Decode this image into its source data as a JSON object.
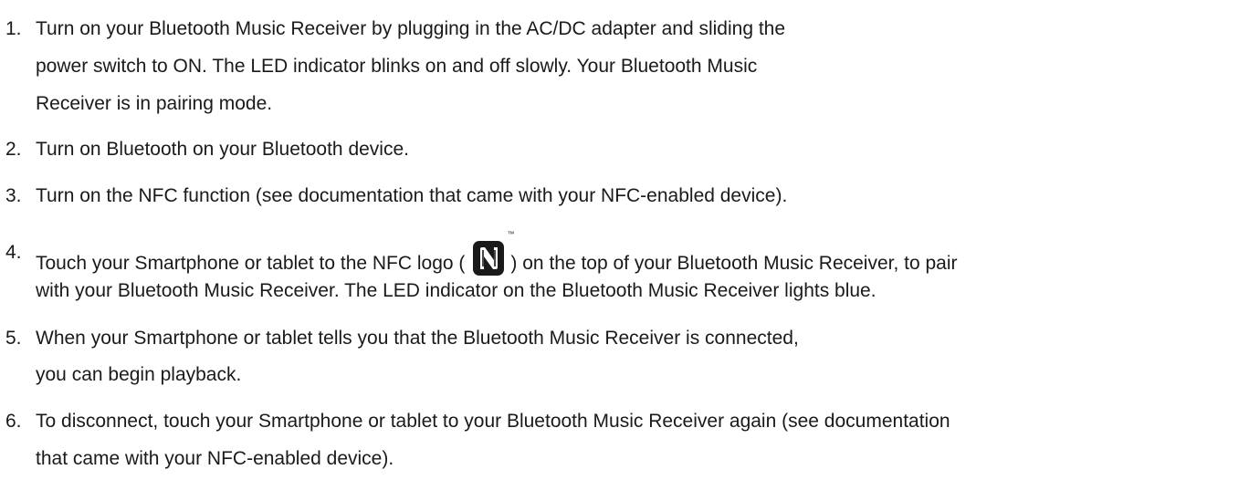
{
  "steps": [
    {
      "number": "1.",
      "lines": [
        "Turn on your Bluetooth Music Receiver by plugging in the AC/DC adapter and sliding the",
        "power switch to ON. The LED indicator blinks on and off slowly. Your Bluetooth Music",
        "Receiver is in pairing mode."
      ]
    },
    {
      "number": "2.",
      "lines": [
        "Turn on Bluetooth on your Bluetooth device."
      ]
    },
    {
      "number": "3.",
      "lines": [
        "Turn on the NFC function (see documentation that came with your NFC-enabled device)."
      ]
    },
    {
      "number": "4.",
      "line1_before_logo": "Touch your Smartphone or tablet to the NFC logo (",
      "line1_after_logo": ") on the top of your Bluetooth Music Receiver, to pair",
      "logo_trademark": "™",
      "logo_icon": "nfc-n-mark-icon",
      "lines_rest": [
        "with your Bluetooth Music Receiver. The LED indicator on the Bluetooth Music Receiver lights blue."
      ]
    },
    {
      "number": "5.",
      "lines": [
        "When your Smartphone or tablet tells you that the Bluetooth Music Receiver is connected,",
        "you can begin playback."
      ]
    },
    {
      "number": "6.",
      "lines": [
        "To disconnect, touch your Smartphone or tablet to your Bluetooth Music Receiver again (see documentation",
        "that came with your NFC-enabled device)."
      ]
    }
  ]
}
